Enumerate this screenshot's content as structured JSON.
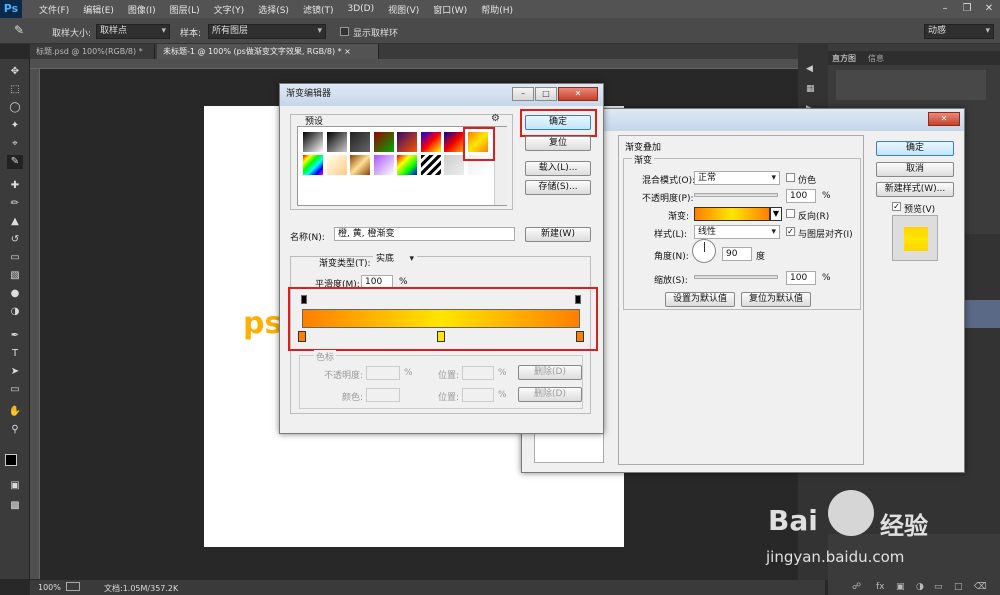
{
  "app": {
    "logo": "Ps"
  },
  "menubar": {
    "items": [
      "文件(F)",
      "编辑(E)",
      "图像(I)",
      "图层(L)",
      "文字(Y)",
      "选择(S)",
      "滤镜(T)",
      "3D(D)",
      "视图(V)",
      "窗口(W)",
      "帮助(H)"
    ]
  },
  "options": {
    "sample_size_label": "取样大小:",
    "sample_size_value": "取样点",
    "sample_label": "样本:",
    "sample_value": "所有图层",
    "show_ring_label": "显示取样环",
    "workspace_value": "动感"
  },
  "tabs": [
    {
      "label": "标题.psd @ 100%(RGB/8) *"
    },
    {
      "label": "未标题-1 @ 100% (ps做渐变文字效果, RGB/8) *"
    }
  ],
  "canvas": {
    "text": "ps"
  },
  "status": {
    "zoom": "100%",
    "doc": "文档:1.05M/357.2K"
  },
  "right_panel": {
    "tab_histogram": "直方图",
    "tab_info": "信息"
  },
  "gradient_editor": {
    "title": "渐变编辑器",
    "presets_label": "预设",
    "buttons": {
      "ok": "确定",
      "reset": "复位",
      "load": "载入(L)...",
      "save": "存储(S)...",
      "new": "新建(W)"
    },
    "name_label": "名称(N):",
    "name_value": "橙, 黄, 橙渐变",
    "type_label": "渐变类型(T):",
    "type_value": "实底",
    "smooth_label": "平滑度(M):",
    "smooth_value": "100",
    "smooth_unit": "%",
    "stops_title": "色标",
    "opacity_label": "不透明度:",
    "color_label": "颜色:",
    "position_label": "位置:",
    "percent": "%",
    "delete_label": "删除(D)",
    "gradient_colors": [
      "#ff7f00",
      "#ffe600",
      "#ff7f00"
    ],
    "color_stops": [
      {
        "position": 0,
        "color": "#ff7f00"
      },
      {
        "position": 50,
        "color": "#ffe600"
      },
      {
        "position": 100,
        "color": "#ff7f00"
      }
    ],
    "opacity_stops": [
      0,
      100
    ]
  },
  "layer_style": {
    "section_title": "渐变叠加",
    "group_title": "渐变",
    "blend_label": "混合模式(O):",
    "blend_value": "正常",
    "dither_label": "仿色",
    "opacity_label": "不透明度(P):",
    "opacity_value": "100",
    "gradient_label": "渐变:",
    "reverse_label": "反向(R)",
    "style_label": "样式(L):",
    "style_value": "线性",
    "align_label": "与图层对齐(I)",
    "angle_label": "角度(N):",
    "angle_value": "90",
    "angle_unit": "度",
    "scale_label": "缩放(S):",
    "scale_value": "100",
    "percent": "%",
    "set_default": "设置为默认值",
    "reset_default": "复位为默认值",
    "buttons": {
      "ok": "确定",
      "cancel": "取消",
      "new_style": "新建样式(W)...",
      "preview": "预览(V)"
    }
  },
  "watermark": {
    "brand": "Bai",
    "brand2": "经验",
    "url": "jingyan.baidu.com"
  }
}
